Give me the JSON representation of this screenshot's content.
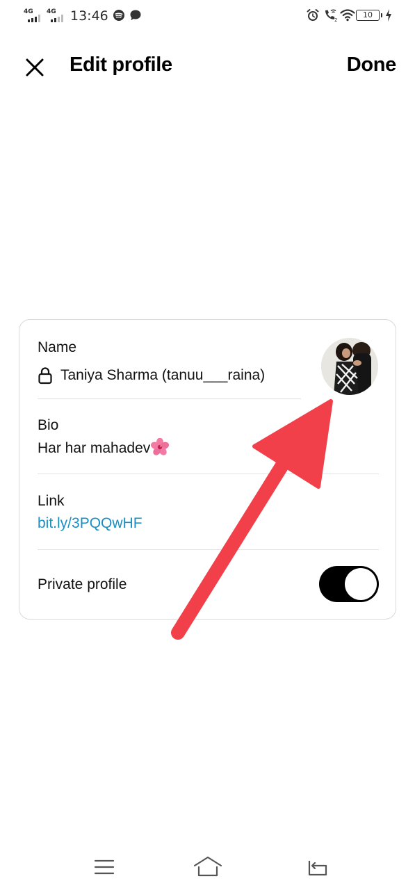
{
  "status_bar": {
    "sim1_network": "4G",
    "sim2_network": "4G",
    "time": "13:46",
    "battery_level": "10",
    "icons": [
      "signal-icon",
      "spotify-icon",
      "message-icon",
      "alarm-icon",
      "wifi-calling-icon",
      "wifi-icon",
      "battery-icon",
      "charging-icon"
    ]
  },
  "header": {
    "title": "Edit profile",
    "done_label": "Done",
    "close_icon": "close-icon"
  },
  "profile": {
    "name_label": "Name",
    "name_value": "Taniya Sharma (tanuu___raina)",
    "bio_label": "Bio",
    "bio_value": "Har har mahadev",
    "bio_emoji": "hibiscus-flower-icon",
    "link_label": "Link",
    "link_value": "bit.ly/3PQQwHF",
    "private_label": "Private profile",
    "private_enabled": true
  },
  "colors": {
    "link": "#1a8fc4",
    "toggle_on": "#000000",
    "annotation_arrow": "#f2404a",
    "card_border": "#d9d9d9"
  },
  "nav_bar": {
    "icons": [
      "menu-icon",
      "home-icon",
      "back-icon"
    ]
  }
}
